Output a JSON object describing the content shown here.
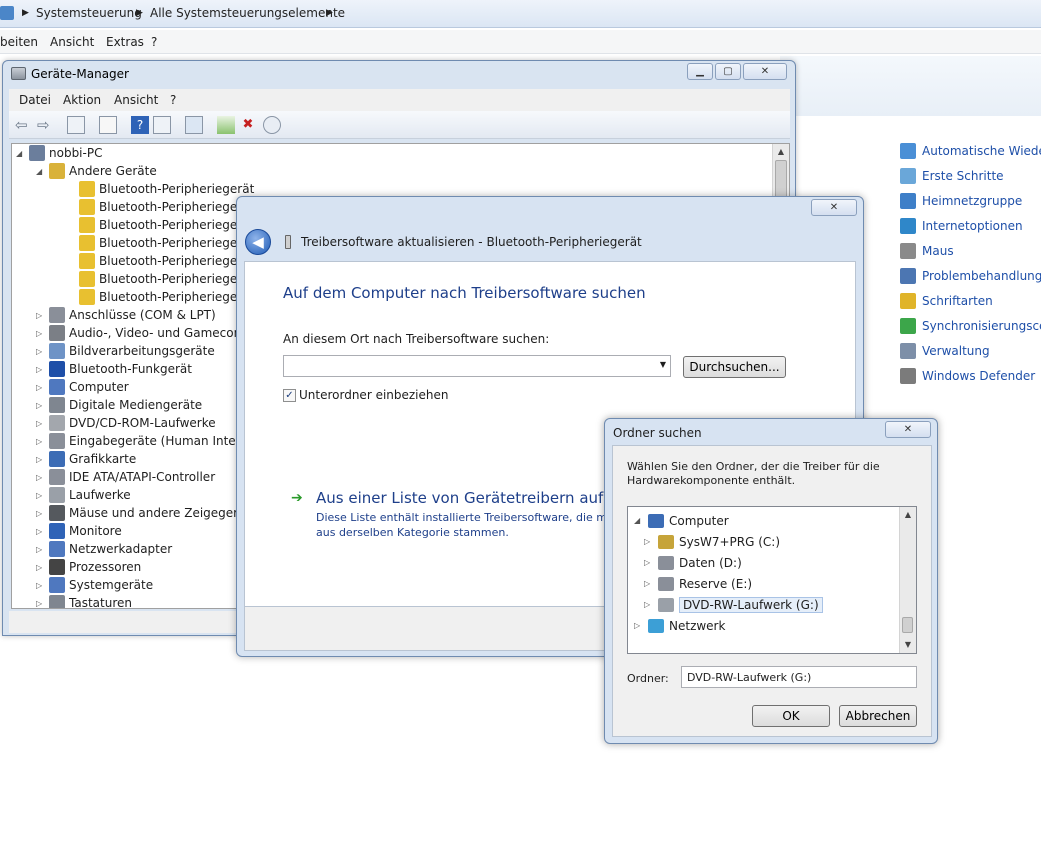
{
  "background": {
    "breadcrumb": [
      "Systemsteuerung",
      "Alle Systemsteuerungselemente"
    ],
    "menu": [
      "beiten",
      "Ansicht",
      "Extras",
      "?"
    ],
    "links": [
      {
        "label": "Automatische Wiederg",
        "icon": "autoplay-icon",
        "color": "#4a8fd6"
      },
      {
        "label": "Erste Schritte",
        "icon": "getting-started-icon",
        "color": "#6aa7d9"
      },
      {
        "label": "Heimnetzgruppe",
        "icon": "homegroup-icon",
        "color": "#3e7fc8"
      },
      {
        "label": "Internetoptionen",
        "icon": "internet-options-icon",
        "color": "#2f87c9"
      },
      {
        "label": "Maus",
        "icon": "mouse-icon",
        "color": "#8a8a8a"
      },
      {
        "label": "Problembehandlung",
        "icon": "troubleshooting-icon",
        "color": "#4c76b2"
      },
      {
        "label": "Schriftarten",
        "icon": "fonts-icon",
        "color": "#e0b429"
      },
      {
        "label": "Synchronisierungscent",
        "icon": "sync-center-icon",
        "color": "#3ca64a"
      },
      {
        "label": "Verwaltung",
        "icon": "administrative-tools-icon",
        "color": "#7d8fa8"
      },
      {
        "label": "Windows Defender",
        "icon": "windows-defender-icon",
        "color": "#7b7b7b"
      }
    ]
  },
  "device_manager": {
    "title": "Geräte-Manager",
    "menu": [
      "Datei",
      "Aktion",
      "Ansicht",
      "?"
    ],
    "tree": {
      "root": "nobbi-PC",
      "other_devices_label": "Andere Geräte",
      "other_devices": [
        "Bluetooth-Peripheriegerät",
        "Bluetooth-Peripheriegerät",
        "Bluetooth-Peripheriegerät",
        "Bluetooth-Peripheriegerät",
        "Bluetooth-Peripheriegerät",
        "Bluetooth-Peripheriegerät",
        "Bluetooth-Peripheriegerät"
      ],
      "categories": [
        "Anschlüsse (COM & LPT)",
        "Audio-, Video- und Gamecontr",
        "Bildverarbeitungsgeräte",
        "Bluetooth-Funkgerät",
        "Computer",
        "Digitale Mediengeräte",
        "DVD/CD-ROM-Laufwerke",
        "Eingabegeräte (Human Interfac",
        "Grafikkarte",
        "IDE ATA/ATAPI-Controller",
        "Laufwerke",
        "Mäuse und andere Zeigegeräte",
        "Monitore",
        "Netzwerkadapter",
        "Prozessoren",
        "Systemgeräte",
        "Tastaturen"
      ]
    }
  },
  "wizard": {
    "title": "Treibersoftware aktualisieren - Bluetooth-Peripheriegerät",
    "heading": "Auf dem Computer nach Treibersoftware suchen",
    "location_label": "An diesem Ort nach Treibersoftware suchen:",
    "location_value": "",
    "browse_button": "Durchsuchen...",
    "include_subfolders": "Unterordner einbeziehen",
    "include_subfolders_checked": true,
    "list_option_title": "Aus einer Liste von Gerätetreibern auf der",
    "list_option_desc_1": "Diese Liste enthält installierte Treibersoftware, die mit d",
    "list_option_desc_2": "aus derselben Kategorie stammen."
  },
  "folder_dialog": {
    "title": "Ordner suchen",
    "description_1": "Wählen Sie den Ordner, der die Treiber für die",
    "description_2": "Hardwarekomponente enthält.",
    "tree": [
      {
        "label": "Computer",
        "level": 0,
        "expanded": true,
        "icon": "computer-icon"
      },
      {
        "label": "SysW7+PRG (C:)",
        "level": 1,
        "expanded": false,
        "icon": "system-drive-icon"
      },
      {
        "label": "Daten (D:)",
        "level": 1,
        "expanded": false,
        "icon": "hard-drive-icon"
      },
      {
        "label": "Reserve (E:)",
        "level": 1,
        "expanded": false,
        "icon": "hard-drive-icon"
      },
      {
        "label": "DVD-RW-Laufwerk (G:)",
        "level": 1,
        "expanded": false,
        "icon": "dvd-drive-icon",
        "selected": true
      },
      {
        "label": "Netzwerk",
        "level": 0,
        "expanded": false,
        "icon": "network-icon"
      }
    ],
    "folder_label": "Ordner:",
    "folder_value": "DVD-RW-Laufwerk (G:)",
    "ok_button": "OK",
    "cancel_button": "Abbrechen"
  }
}
